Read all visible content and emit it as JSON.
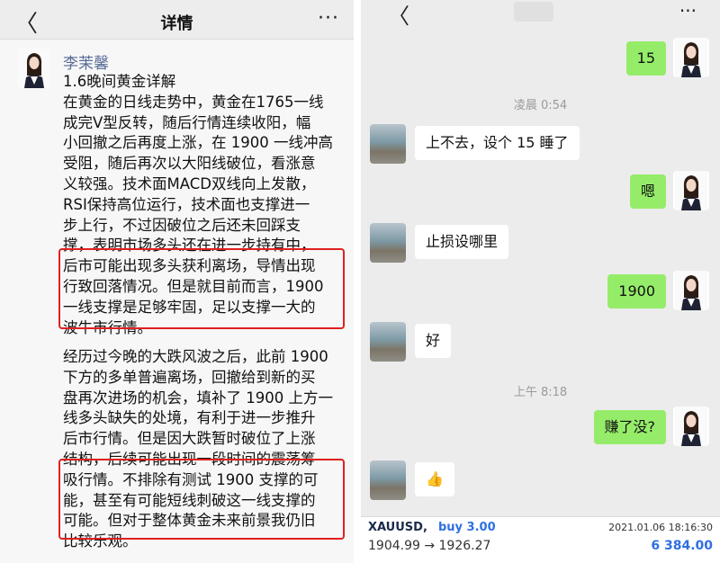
{
  "left": {
    "header": {
      "back_icon": "chevron-left-icon",
      "back_glyph": "〈",
      "title": "详情",
      "more_glyph": "···"
    },
    "poster_name": "李茉馨",
    "para1_lines": [
      "1.6晚间黄金详解",
      "在黄金的日线走势中，黄金在1765一线",
      "成完Ⅴ型反转，随后行情连续收阳，幅",
      "小回撤之后再度上涨，在 1900 一线冲高",
      "受阻，随后再次以大阳线破位，看涨意",
      "义较强。技术面MACD双线向上发散，",
      "RSI保持高位运行，技术面也支撑进一",
      "步上行，不过因破位之后还未回踩支",
      "撑，表明市场多头还在进一步持有中，",
      "后市可能出现多头获利离场，导情出现",
      "行致回落情况。但是就目前而言，1900",
      "一线支撑是足够牢固，足以支撑一大的",
      "波牛市行情。"
    ],
    "para2_lines": [
      "经历过今晚的大跌风波之后，此前 1900",
      "下方的多单普遍离场，回撤给到新的买",
      "盘再次进场的机会，填补了 1900 上方一",
      "线多头缺失的处境，有利于进一步推升",
      "后市行情。但是因大跌暂时破位了上涨",
      "结构，后续可能出现一段时间的震荡筹",
      "吸行情。不排除有测试 1900 支撑的可",
      "能，甚至有可能短线刺破这一线支撑的",
      "可能。但对于整体黄金未来前景我仍旧",
      "比较乐观。"
    ]
  },
  "right": {
    "header": {
      "back_glyph": "〈",
      "more_glyph": "···"
    },
    "timestamps": [
      "凌晨 0:54",
      "上午 8:18"
    ],
    "messages": [
      {
        "from": "me",
        "text": "15"
      },
      {
        "from": "other",
        "text": "上不去，设个 15 睡了"
      },
      {
        "from": "me",
        "text": "嗯"
      },
      {
        "from": "other",
        "text": "止损设哪里"
      },
      {
        "from": "me",
        "text": "1900"
      },
      {
        "from": "other",
        "text": "好"
      },
      {
        "from": "me",
        "text": "赚了没?"
      },
      {
        "from": "other",
        "text": "👍"
      }
    ],
    "trade": {
      "symbol": "XAUUSD,",
      "side": "buy 3.00",
      "datetime": "2021.01.06 18:16:30",
      "price_move": "1904.99 → 1926.27",
      "profit": "6 384.00"
    }
  },
  "colors": {
    "my_bubble": "#95ec69",
    "highlight_box": "#e02020",
    "name_link": "#576b95",
    "trade_blue": "#2f6fe0"
  }
}
